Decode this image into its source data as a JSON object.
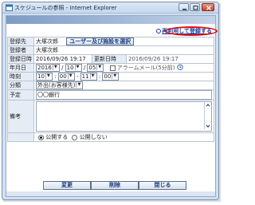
{
  "window": {
    "title": "スケジュールの参照 - Internet Explorer",
    "colors": {
      "frame": "#cfe0f3",
      "close": "#c2432b",
      "highlight": "#e01010",
      "link": "#1a3aa0"
    }
  },
  "header": {
    "reuse_link": "再利用して登録する"
  },
  "form": {
    "registrant_label": "登録先",
    "registrant_value": "大塚次郎",
    "user_select_button": "ユーザー及び施設を選択",
    "author_label": "登録者",
    "author_value": "大塚次郎",
    "created_label": "登録日時",
    "created_value": "2016/09/26 19:17",
    "updated_label": "更新日時",
    "updated_value": "2016/09/26 19:17",
    "date_label": "年月日",
    "date_year": "2016",
    "date_month": "10",
    "date_day": "05",
    "date_sep": "/",
    "alarm_label": "アラームメール(5分前)",
    "time_label": "時刻",
    "time_start_hour": "10",
    "time_start_min": "00",
    "time_end_hour": "11",
    "time_end_min": "00",
    "time_sep": "-",
    "category_label": "分類",
    "category_value": "外出(お客様先)",
    "plan_label": "予定",
    "plan_value": "〇〇銀行",
    "note_label": "備考",
    "public_label": "公開する",
    "private_label": "公開しない"
  },
  "footer": {
    "change_button": "変更",
    "delete_button": "削除",
    "close_button": "閉じる"
  }
}
